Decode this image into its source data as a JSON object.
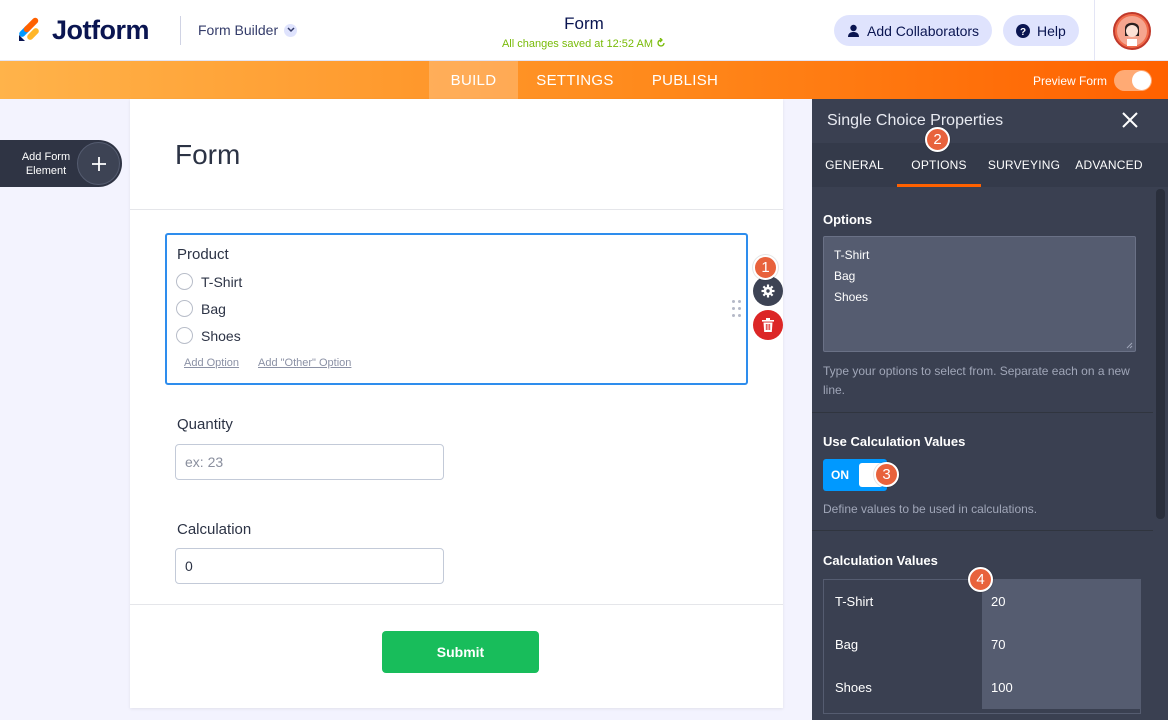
{
  "header": {
    "brand": "Jotform",
    "builder_menu": "Form Builder",
    "form_title": "Form",
    "saved_status": "All changes saved at 12:52 AM",
    "add_collaborators": "Add Collaborators",
    "help": "Help"
  },
  "nav": {
    "tabs": [
      "BUILD",
      "SETTINGS",
      "PUBLISH"
    ],
    "active_tab": "BUILD",
    "preview_label": "Preview Form",
    "preview_enabled": false
  },
  "sidebar": {
    "add_element_line1": "Add Form",
    "add_element_line2": "Element"
  },
  "form": {
    "title": "Form",
    "product": {
      "label": "Product",
      "options": [
        "T-Shirt",
        "Bag",
        "Shoes"
      ],
      "add_option": "Add Option",
      "add_other_option": "Add \"Other\" Option"
    },
    "quantity": {
      "label": "Quantity",
      "placeholder": "ex: 23"
    },
    "calculation": {
      "label": "Calculation",
      "value": "0"
    },
    "submit_label": "Submit"
  },
  "panel": {
    "title": "Single Choice Properties",
    "tabs": [
      "GENERAL",
      "OPTIONS",
      "SURVEYING",
      "ADVANCED"
    ],
    "active_tab": "OPTIONS",
    "options_section": {
      "title": "Options",
      "lines": [
        "T-Shirt",
        "Bag",
        "Shoes"
      ],
      "help": "Type your options to select from. Separate each on a new line."
    },
    "calc_values_section": {
      "title": "Use Calculation Values",
      "toggle_label": "ON",
      "enabled": true,
      "help": "Define values to be used in calculations."
    },
    "calc_table": {
      "title": "Calculation Values",
      "rows": [
        {
          "name": "T-Shirt",
          "value": "20"
        },
        {
          "name": "Bag",
          "value": "70"
        },
        {
          "name": "Shoes",
          "value": "100"
        }
      ]
    }
  },
  "badges": [
    "1",
    "2",
    "3",
    "4"
  ],
  "colors": {
    "brand_orange": "#ff6100",
    "accent_blue": "#2e8ded",
    "submit_green": "#18bd5b",
    "delete_red": "#dc2626",
    "badge": "#e8623c"
  }
}
